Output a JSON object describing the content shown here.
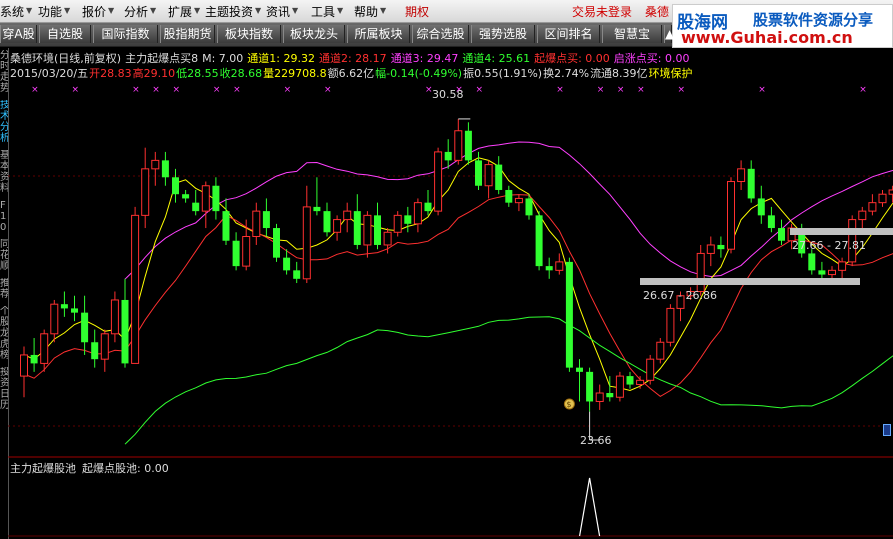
{
  "menu": {
    "items": [
      "系统",
      "功能",
      "报价",
      "分析",
      "扩展",
      "主题投资",
      "资讯",
      "工具",
      "帮助"
    ],
    "qiquan": "期权",
    "login_status": "交易未登录",
    "brand_partial": "桑德"
  },
  "logo": {
    "name": "股海网",
    "slogan": "股票软件资源分享",
    "url": "www.Guhai.com.cn"
  },
  "toolbar": {
    "buttons": [
      "穿A股",
      "自选股",
      "国际指数",
      "股指期货",
      "板块指数",
      "板块龙头",
      "所属板块",
      "综合选股",
      "强势选股",
      "区间排名",
      "智慧宝",
      "▲"
    ]
  },
  "side_tabs": [
    "分时走势",
    "技术分析",
    "基本资料",
    "F10",
    "同花顺",
    "推荐",
    "个股龙虎榜",
    "投资日历"
  ],
  "indicator_line": {
    "title": "桑德环境(日线,前复权)",
    "formula": "主力起爆点买8",
    "m": "M: 7.00",
    "ch1": "通道1: 29.32",
    "ch2": "通道2: 28.17",
    "ch3": "通道3: 29.47",
    "ch4": "通道4: 25.61",
    "buy": "起爆点买: 0.00",
    "start": "启涨点买: 0.00",
    "colors": {
      "title": "#dddddd",
      "m": "#dddddd",
      "ch1": "#ffff00",
      "ch2": "#ff3030",
      "ch3": "#ff40ff",
      "ch4": "#30ff30",
      "buy": "#ff3030",
      "start": "#ff40ff"
    }
  },
  "quote_line": {
    "date": "2015/03/20/五",
    "open": "开28.83",
    "high": "高29.10",
    "low": "低28.55",
    "close": "收28.68",
    "volume": "量229708.8",
    "amount": "额6.62亿",
    "change": "幅-0.14(-0.49%)",
    "amplitude": "振0.55(1.91%)",
    "turnover": "换2.74%",
    "float": "流通8.39亿",
    "env": "环境保护"
  },
  "annotations": {
    "high_label": "30.58",
    "low_label": "23.66",
    "range1": "27.66 - 27.81",
    "range2": "26.67 - 26.86",
    "coin": "$"
  },
  "sub_chart": {
    "title": "主力起爆股池",
    "value": "起爆点股池: 0.00"
  },
  "chart_data": {
    "type": "candlestick",
    "ohlc": [
      [
        24.5,
        25.2,
        24.0,
        25.0
      ],
      [
        25.0,
        25.4,
        24.6,
        24.8
      ],
      [
        24.8,
        25.6,
        24.6,
        25.5
      ],
      [
        25.5,
        26.3,
        25.3,
        26.2
      ],
      [
        26.2,
        26.5,
        25.9,
        26.1
      ],
      [
        26.1,
        26.4,
        25.8,
        26.0
      ],
      [
        26.0,
        26.4,
        25.0,
        25.3
      ],
      [
        25.3,
        25.6,
        24.7,
        24.9
      ],
      [
        24.9,
        25.6,
        24.6,
        25.5
      ],
      [
        25.5,
        26.5,
        25.3,
        26.3
      ],
      [
        26.3,
        26.8,
        24.7,
        24.8
      ],
      [
        24.8,
        28.5,
        24.8,
        28.3
      ],
      [
        28.3,
        29.9,
        28.0,
        29.4
      ],
      [
        29.4,
        29.8,
        29.0,
        29.6
      ],
      [
        29.6,
        29.8,
        29.0,
        29.2
      ],
      [
        29.2,
        29.4,
        28.6,
        28.8
      ],
      [
        28.8,
        28.9,
        28.6,
        28.7
      ],
      [
        28.6,
        28.9,
        28.3,
        28.4
      ],
      [
        28.4,
        29.1,
        28.0,
        29.0
      ],
      [
        29.0,
        29.2,
        28.2,
        28.4
      ],
      [
        28.4,
        28.7,
        27.6,
        27.7
      ],
      [
        27.7,
        27.9,
        27.0,
        27.1
      ],
      [
        27.1,
        28.2,
        27.0,
        27.8
      ],
      [
        27.8,
        28.6,
        27.6,
        28.4
      ],
      [
        28.4,
        28.7,
        27.8,
        28.0
      ],
      [
        28.0,
        28.1,
        27.2,
        27.3
      ],
      [
        27.3,
        27.5,
        26.9,
        27.0
      ],
      [
        27.0,
        27.2,
        26.7,
        26.8
      ],
      [
        26.8,
        29.0,
        26.7,
        28.5
      ],
      [
        28.5,
        29.2,
        28.3,
        28.4
      ],
      [
        28.4,
        28.6,
        27.8,
        27.9
      ],
      [
        27.9,
        28.3,
        27.7,
        28.2
      ],
      [
        28.2,
        28.6,
        27.9,
        28.4
      ],
      [
        28.4,
        28.8,
        27.5,
        27.6
      ],
      [
        27.6,
        28.4,
        27.3,
        28.3
      ],
      [
        28.3,
        28.6,
        27.5,
        27.6
      ],
      [
        27.6,
        28.0,
        27.4,
        27.9
      ],
      [
        27.9,
        28.4,
        27.8,
        28.3
      ],
      [
        28.3,
        28.5,
        27.9,
        28.1
      ],
      [
        28.1,
        28.7,
        27.9,
        28.6
      ],
      [
        28.6,
        28.9,
        28.3,
        28.4
      ],
      [
        28.4,
        29.9,
        28.3,
        29.8
      ],
      [
        29.8,
        30.1,
        29.4,
        29.6
      ],
      [
        29.6,
        30.58,
        29.5,
        30.3
      ],
      [
        30.3,
        30.5,
        29.5,
        29.6
      ],
      [
        29.6,
        29.8,
        28.9,
        29.0
      ],
      [
        29.0,
        29.6,
        28.7,
        29.5
      ],
      [
        29.5,
        29.7,
        28.8,
        28.9
      ],
      [
        28.9,
        29.0,
        28.5,
        28.6
      ],
      [
        28.6,
        28.8,
        28.4,
        28.7
      ],
      [
        28.7,
        28.8,
        28.2,
        28.3
      ],
      [
        28.3,
        28.4,
        27.0,
        27.1
      ],
      [
        27.1,
        27.3,
        26.8,
        27.0
      ],
      [
        27.0,
        27.4,
        26.9,
        27.2
      ],
      [
        27.2,
        27.3,
        24.6,
        24.7
      ],
      [
        24.7,
        24.9,
        23.9,
        24.6
      ],
      [
        24.6,
        24.7,
        23.66,
        23.9
      ],
      [
        23.9,
        24.3,
        23.7,
        24.1
      ],
      [
        24.1,
        24.5,
        23.9,
        24.0
      ],
      [
        24.0,
        24.6,
        23.9,
        24.5
      ],
      [
        24.5,
        24.6,
        24.2,
        24.3
      ],
      [
        24.3,
        24.5,
        24.2,
        24.4
      ],
      [
        24.4,
        25.0,
        24.3,
        24.9
      ],
      [
        24.9,
        25.4,
        24.8,
        25.3
      ],
      [
        25.3,
        26.2,
        25.2,
        26.1
      ],
      [
        26.1,
        26.5,
        25.8,
        26.4
      ],
      [
        26.4,
        26.6,
        26.3,
        26.5
      ],
      [
        26.5,
        27.6,
        26.4,
        27.4
      ],
      [
        27.4,
        27.8,
        27.1,
        27.6
      ],
      [
        27.6,
        27.8,
        27.3,
        27.5
      ],
      [
        27.5,
        29.2,
        27.4,
        29.1
      ],
      [
        29.1,
        29.6,
        28.9,
        29.4
      ],
      [
        29.4,
        29.6,
        28.6,
        28.7
      ],
      [
        28.7,
        29.0,
        28.1,
        28.3
      ],
      [
        28.3,
        28.5,
        27.9,
        28.0
      ],
      [
        28.0,
        28.2,
        27.6,
        27.7
      ],
      [
        27.7,
        28.1,
        27.5,
        28.0
      ],
      [
        28.0,
        28.1,
        27.3,
        27.4
      ],
      [
        27.4,
        27.5,
        26.9,
        27.0
      ],
      [
        27.0,
        27.2,
        26.8,
        26.9
      ],
      [
        26.9,
        27.1,
        26.7,
        27.0
      ],
      [
        27.0,
        27.3,
        26.8,
        27.2
      ],
      [
        27.2,
        28.3,
        27.1,
        28.2
      ],
      [
        28.2,
        28.5,
        28.0,
        28.4
      ],
      [
        28.4,
        28.8,
        28.3,
        28.6
      ],
      [
        28.6,
        28.9,
        28.5,
        28.8
      ],
      [
        28.8,
        29.0,
        28.6,
        28.9
      ],
      [
        28.83,
        29.1,
        28.55,
        28.68
      ]
    ],
    "ylim": [
      22.8,
      31.5
    ],
    "signal_peak_index": 56
  }
}
